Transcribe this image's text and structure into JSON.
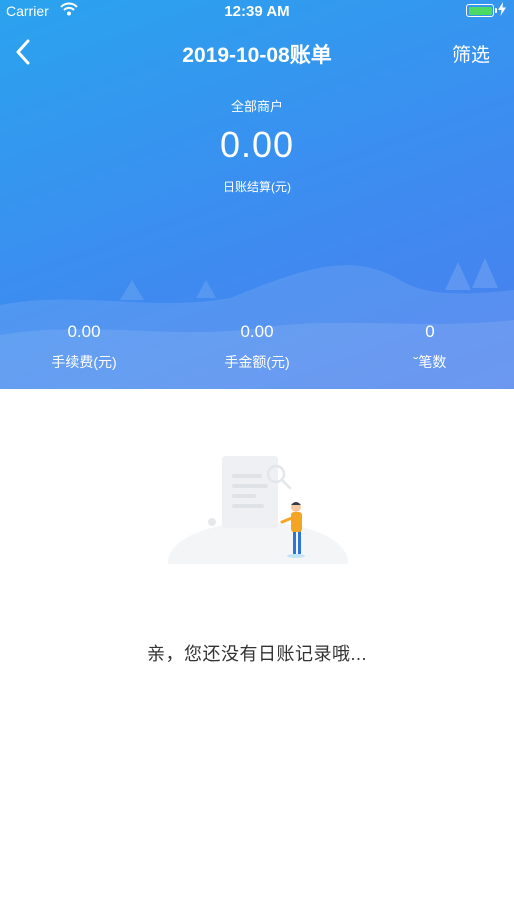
{
  "status_bar": {
    "carrier": "Carrier",
    "time": "12:39 AM",
    "battery_color": "#4cd964",
    "icons": [
      "wifi-icon",
      "battery-icon",
      "charging-bolt-icon"
    ]
  },
  "nav": {
    "back_icon": "chevron-left-icon",
    "title": "2019-10-08账单",
    "filter_label": "筛选"
  },
  "summary": {
    "merchant_label": "全部商户",
    "total_amount": "0.00",
    "total_caption": "日账结算(元)"
  },
  "stats": [
    {
      "value": "0.00",
      "label": "手续费(元)"
    },
    {
      "value": "0.00",
      "label": "手金额(元)"
    },
    {
      "value": "0",
      "label": "˘笔数"
    }
  ],
  "empty_state": {
    "illustration": "empty-bill-illustration",
    "message": "亲，您还没有日账记录哦..."
  },
  "colors": {
    "header_gradient_start": "#2aa3ee",
    "header_gradient_end": "#4a7fee",
    "text_on_header": "#ffffff",
    "empty_text": "#333333"
  }
}
